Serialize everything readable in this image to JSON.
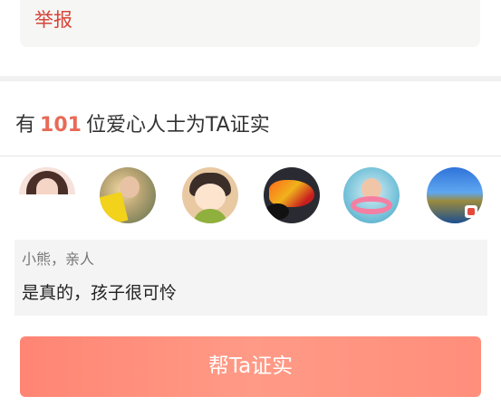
{
  "report": {
    "label": "举报"
  },
  "verify": {
    "prefix": "有",
    "count": "101",
    "suffix": "位爱心人士为TA证实"
  },
  "avatars": [
    {
      "icon": "avatar-woman-icon"
    },
    {
      "icon": "avatar-child-reading-icon"
    },
    {
      "icon": "avatar-cartoon-girl-icon"
    },
    {
      "icon": "avatar-motorcycle-icon"
    },
    {
      "icon": "avatar-child-swimming-icon"
    },
    {
      "icon": "avatar-landscape-icon"
    }
  ],
  "comment": {
    "author": "小熊，亲人",
    "text": "是真的，孩子很可怜"
  },
  "action": {
    "button_label": "帮Ta证实"
  },
  "colors": {
    "accent": "#e86a58",
    "report": "#d6453a",
    "button": "#ff8e7b"
  }
}
